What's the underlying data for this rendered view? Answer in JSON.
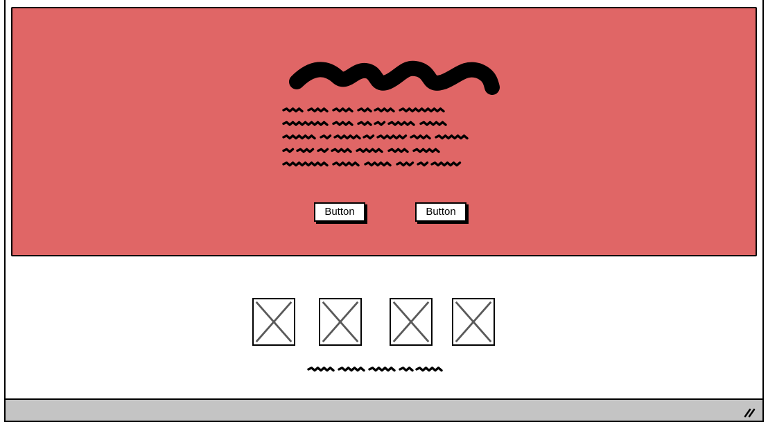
{
  "colors": {
    "hero_background": "#e06666",
    "status_bar_background": "#c4c4c4",
    "placeholder_ink": "#000000",
    "image_cross": "#5a5a5a"
  },
  "hero": {
    "heading": "",
    "paragraph": "",
    "buttons": [
      {
        "label": "Button"
      },
      {
        "label": "Button"
      }
    ]
  },
  "gallery": {
    "images": [
      {
        "icon": "image-placeholder-icon"
      },
      {
        "icon": "image-placeholder-icon"
      },
      {
        "icon": "image-placeholder-icon"
      },
      {
        "icon": "image-placeholder-icon"
      }
    ],
    "caption": ""
  },
  "status_bar": {
    "icon": "resize-grip-icon"
  }
}
